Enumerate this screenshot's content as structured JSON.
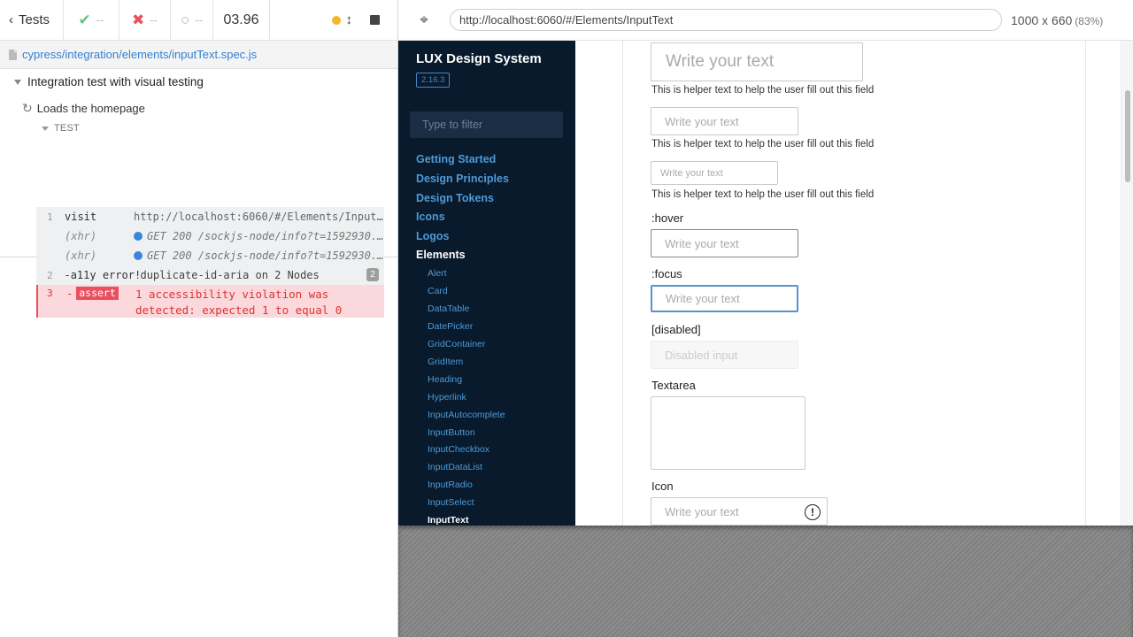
{
  "reporter": {
    "tests_label": "Tests",
    "passed": "--",
    "failed": "--",
    "pending": "--",
    "duration": "03.96",
    "spec_path": "cypress/integration/elements/inputText.spec.js",
    "suite_title": "Integration test with visual testing",
    "test_title": "Loads the homepage",
    "test_section_label": "TEST",
    "commands": [
      {
        "num": "1",
        "name": "visit",
        "message": "http://localhost:6060/#/Elements/InputText"
      },
      {
        "name": "(xhr)",
        "message": "GET 200 /sockjs-node/info?t=1592930..."
      },
      {
        "name": "(xhr)",
        "message": "GET 200 /sockjs-node/info?t=1592930..."
      },
      {
        "num": "2",
        "name": "-a11y error!",
        "message": "duplicate-id-aria on 2 Nodes",
        "badge": "2"
      },
      {
        "num": "3",
        "name": "assert",
        "prefix": "-",
        "message": "1 accessibility violation was detected: expected 1 to equal 0"
      }
    ],
    "colors": {
      "passed": "#6ac180",
      "failed": "#e94f5f",
      "running": "#f1b827"
    }
  },
  "aut": {
    "url": "http://localhost:6060/#/Elements/InputText",
    "viewport": "1000 x 660",
    "scale": "(83%)"
  },
  "lux": {
    "title": "LUX Design System",
    "version": "2.16.3",
    "filter_placeholder": "Type to filter",
    "nav_top": [
      "Getting Started",
      "Design Principles",
      "Design Tokens",
      "Icons",
      "Logos",
      "Elements"
    ],
    "nav_sub": [
      "Alert",
      "Card",
      "DataTable",
      "DatePicker",
      "GridContainer",
      "GridItem",
      "Heading",
      "Hyperlink",
      "InputAutocomplete",
      "InputButton",
      "InputCheckbox",
      "InputDataList",
      "InputRadio",
      "InputSelect",
      "InputText"
    ],
    "content": {
      "placeholder": "Write your text",
      "helper": "This is helper text to help the user fill out this field",
      "hover_label": ":hover",
      "focus_label": ":focus",
      "disabled_label": "[disabled]",
      "disabled_placeholder": "Disabled input",
      "textarea_label": "Textarea",
      "icon_label": "Icon"
    }
  }
}
